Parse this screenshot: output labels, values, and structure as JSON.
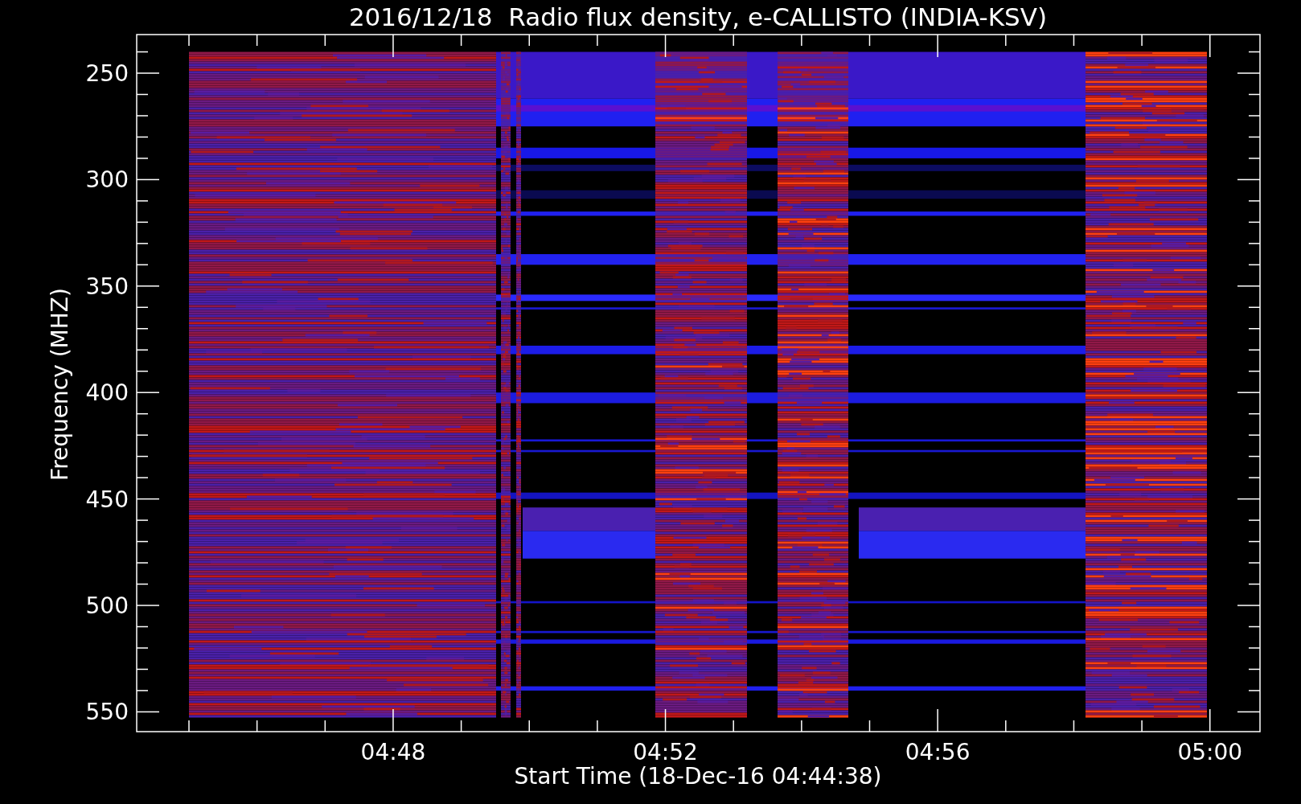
{
  "title": "2016/12/18  Radio flux density, e-CALLISTO (INDIA-KSV)",
  "y_axis": {
    "label": "Frequency (MHZ)",
    "ticks": [
      "250",
      "300",
      "350",
      "400",
      "450",
      "500",
      "550"
    ]
  },
  "x_axis": {
    "label": "Start Time (18-Dec-16 04:44:38)",
    "ticks": [
      "04:48",
      "04:52",
      "04:56",
      "05:00"
    ]
  }
}
